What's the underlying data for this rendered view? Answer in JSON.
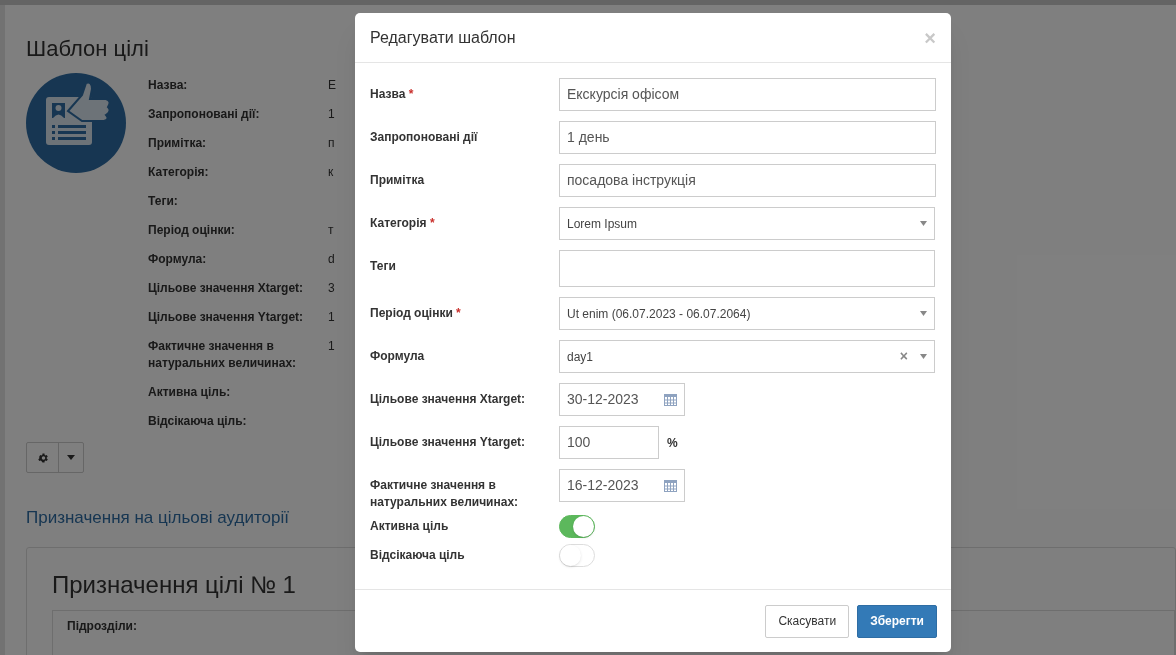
{
  "page": {
    "title": "Шаблон цілі",
    "details": [
      {
        "label": "Назва:",
        "value": "Е"
      },
      {
        "label": "Запропоновані дії:",
        "value": "1"
      },
      {
        "label": "Примітка:",
        "value": "п"
      },
      {
        "label": "Категорія:",
        "value": "к"
      },
      {
        "label": "Теги:"
      },
      {
        "label": "Період оцінки:",
        "value": "т"
      },
      {
        "label": "Формула:",
        "value": "d"
      },
      {
        "label": "Цільове значення Xtarget:",
        "value": "3"
      },
      {
        "label": "Цільове значення Ytarget:",
        "value": "1"
      },
      {
        "label": "Фактичне значення в натуральних величинах:",
        "value": "1"
      },
      {
        "label": "Активна ціль:"
      },
      {
        "label": "Відсікаюча ціль:"
      }
    ],
    "section_link": "Призначення на цільові аудиторії",
    "card_title": "Призначення цілі № 1",
    "table_label": "Підрозділи:"
  },
  "modal": {
    "title": "Редагувати шаблон",
    "close": "×",
    "fields": [
      {
        "kind": "text",
        "label": "Назва",
        "required_mark": "*",
        "value": "Екскурсія офісом"
      },
      {
        "kind": "text",
        "label": "Запропоновані дії",
        "value": "1 день"
      },
      {
        "kind": "text",
        "label": "Примітка",
        "value": "посадова інструкція"
      },
      {
        "kind": "select",
        "label": "Категорія",
        "required_mark": "*",
        "value": "Lorem Ipsum"
      },
      {
        "kind": "tags",
        "label": "Теги"
      },
      {
        "kind": "select",
        "label": "Період оцінки",
        "required_mark": "*",
        "value": "Ut enim (06.07.2023 - 06.07.2064)"
      },
      {
        "kind": "select",
        "label": "Формула",
        "value": "day1",
        "clear": "×"
      },
      {
        "kind": "date",
        "label": "Цільове значення Xtarget:",
        "value": "30-12-2023"
      },
      {
        "kind": "number",
        "label": "Цільове значення Ytarget:",
        "value": "100",
        "unit": "%"
      },
      {
        "kind": "date",
        "label": "Фактичне значення в натуральних величинах:",
        "value": "16-12-2023"
      },
      {
        "kind": "toggle",
        "label": "Активна ціль",
        "on": true
      },
      {
        "kind": "toggle",
        "label": "Відсікаюча ціль",
        "on": false
      }
    ],
    "buttons": [
      {
        "label": "Скасувати",
        "primary": false
      },
      {
        "label": "Зберегти",
        "primary": true
      }
    ]
  }
}
